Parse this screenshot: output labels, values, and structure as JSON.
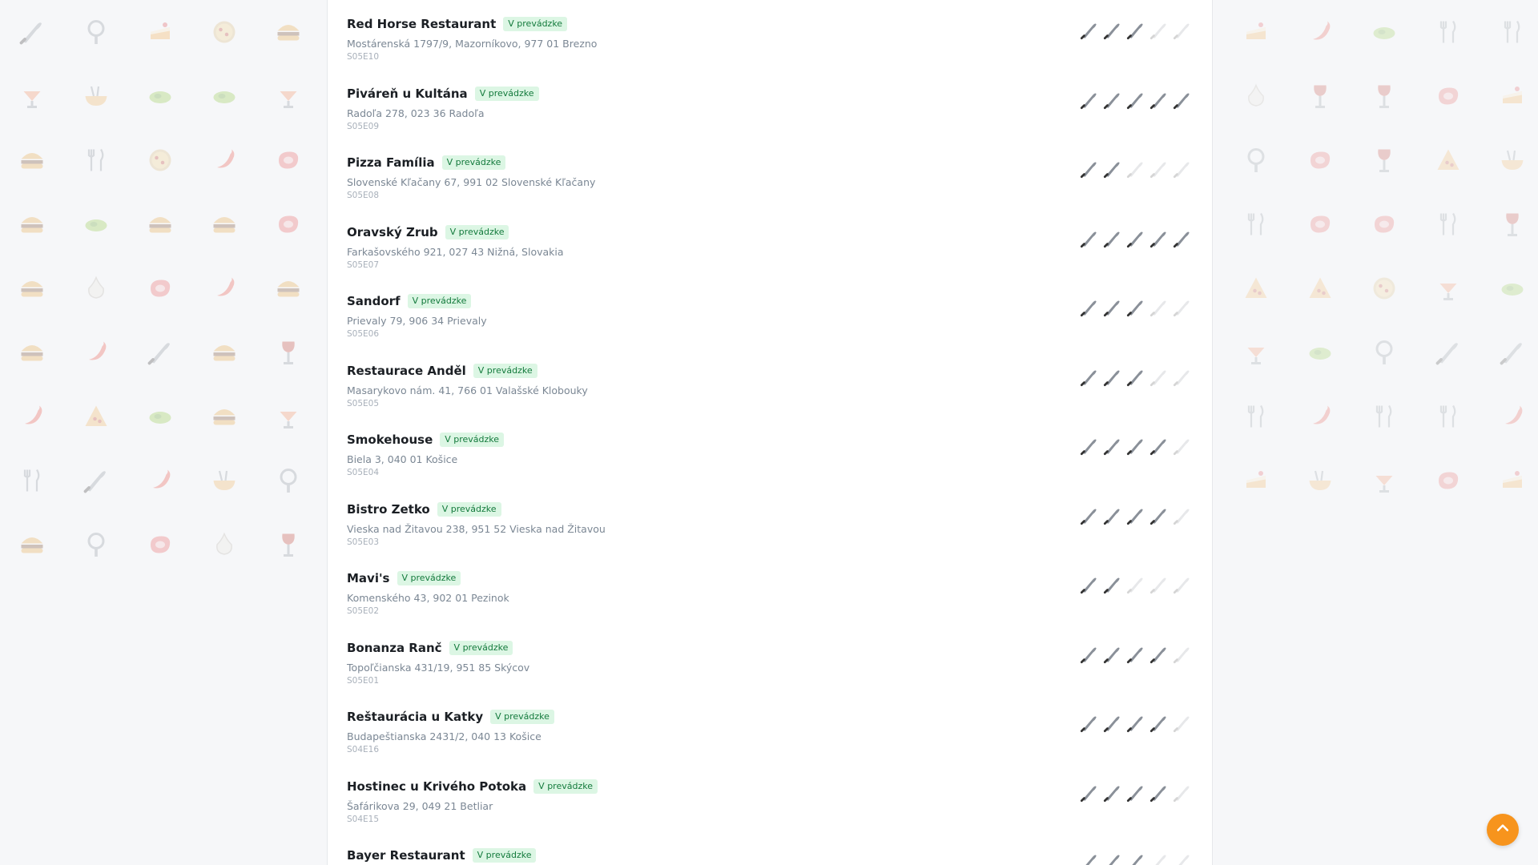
{
  "restaurants": [
    {
      "name": "Red Horse Restaurant",
      "status": "V prevádzke",
      "address": "Mostárenská 1797/9, Mazorníkovo, 977 01 Brezno",
      "episode": "S05E10",
      "rating": 3
    },
    {
      "name": "Piváreň u Kultána",
      "status": "V prevádzke",
      "address": "Radoľa 278, 023 36 Radoľa",
      "episode": "S05E09",
      "rating": 5
    },
    {
      "name": "Pizza Família",
      "status": "V prevádzke",
      "address": "Slovenské Kľačany 67, 991 02 Slovenské Kľačany",
      "episode": "S05E08",
      "rating": 2
    },
    {
      "name": "Oravský Zrub",
      "status": "V prevádzke",
      "address": "Farkašovského 921, 027 43 Nižná, Slovakia",
      "episode": "S05E07",
      "rating": 5
    },
    {
      "name": "Sandorf",
      "status": "V prevádzke",
      "address": "Prievaly 79, 906 34 Prievaly",
      "episode": "S05E06",
      "rating": 3
    },
    {
      "name": "Restaurace Anděl",
      "status": "V prevádzke",
      "address": "Masarykovo nám. 41, 766 01 Valašské Klobouky",
      "episode": "S05E05",
      "rating": 3
    },
    {
      "name": "Smokehouse",
      "status": "V prevádzke",
      "address": "Biela 3, 040 01 Košice",
      "episode": "S05E04",
      "rating": 4
    },
    {
      "name": "Bistro Zetko",
      "status": "V prevádzke",
      "address": "Vieska nad Žitavou 238, 951 52 Vieska nad Žitavou",
      "episode": "S05E03",
      "rating": 4
    },
    {
      "name": "Mavi's",
      "status": "V prevádzke",
      "address": "Komenského 43, 902 01 Pezinok",
      "episode": "S05E02",
      "rating": 2
    },
    {
      "name": "Bonanza Ranč",
      "status": "V prevádzke",
      "address": "Topoľčianska 431/19, 951 85 Skýcov",
      "episode": "S05E01",
      "rating": 4
    },
    {
      "name": "Reštaurácia u Katky",
      "status": "V prevádzke",
      "address": "Budapeštianska 2431/2, 040 13 Košice",
      "episode": "S04E16",
      "rating": 4
    },
    {
      "name": "Hostinec u Krivého Potoka",
      "status": "V prevádzke",
      "address": "Šafárikova 29, 049 21 Betliar",
      "episode": "S04E15",
      "rating": 4
    },
    {
      "name": "Bayer Restaurant",
      "status": "V prevádzke",
      "address": "",
      "episode": "",
      "rating": 3
    }
  ],
  "rating_max": 5,
  "rating_icon": "knife-icon",
  "scroll_top_icon": "chevron-up-icon",
  "colors": {
    "badge_bg": "#dcf6e4",
    "badge_text": "#137a3c",
    "accent": "#f7941d"
  },
  "decor_left_icons": [
    "knife-icon",
    "whisk-icon",
    "cake-icon",
    "pizza-icon",
    "burger-icon",
    "cocktail-icon",
    "noodles-icon",
    "salad-icon",
    "salad-icon",
    "cocktail-icon",
    "burger-icon",
    "fork-knife-icon",
    "pizza-icon",
    "chili-icon",
    "steak-icon",
    "burger-icon",
    "salad-icon",
    "burger-icon",
    "burger-icon",
    "steak-icon",
    "burger-icon",
    "garlic-icon",
    "steak-icon",
    "chili-icon",
    "burger-icon",
    "burger-icon",
    "chili-icon",
    "knife-icon",
    "burger-icon",
    "wine-icon",
    "chili-icon",
    "pizza-slice-icon",
    "salad-icon",
    "burger-icon",
    "cocktail-icon",
    "fork-knife-icon",
    "knife-icon",
    "chili-icon",
    "noodles-icon",
    "whisk-icon",
    "burger-icon",
    "whisk-icon",
    "steak-icon",
    "garlic-icon",
    "wine-icon"
  ],
  "decor_right_icons": [
    "cake-icon",
    "chili-icon",
    "salad-icon",
    "fork-knife-icon",
    "fork-knife-icon",
    "garlic-icon",
    "wine-icon",
    "wine-icon",
    "steak-icon",
    "cake-icon",
    "whisk-icon",
    "steak-icon",
    "wine-icon",
    "pizza-slice-icon",
    "noodles-icon",
    "fork-knife-icon",
    "steak-icon",
    "steak-icon",
    "fork-knife-icon",
    "wine-icon",
    "pizza-slice-icon",
    "pizza-slice-icon",
    "pizza-icon",
    "cocktail-icon",
    "salad-icon",
    "cocktail-icon",
    "salad-icon",
    "whisk-icon",
    "knife-icon",
    "knife-icon",
    "fork-knife-icon",
    "chili-icon",
    "fork-knife-icon",
    "fork-knife-icon",
    "chili-icon",
    "cake-icon",
    "noodles-icon",
    "cocktail-icon",
    "steak-icon",
    "cake-icon"
  ]
}
